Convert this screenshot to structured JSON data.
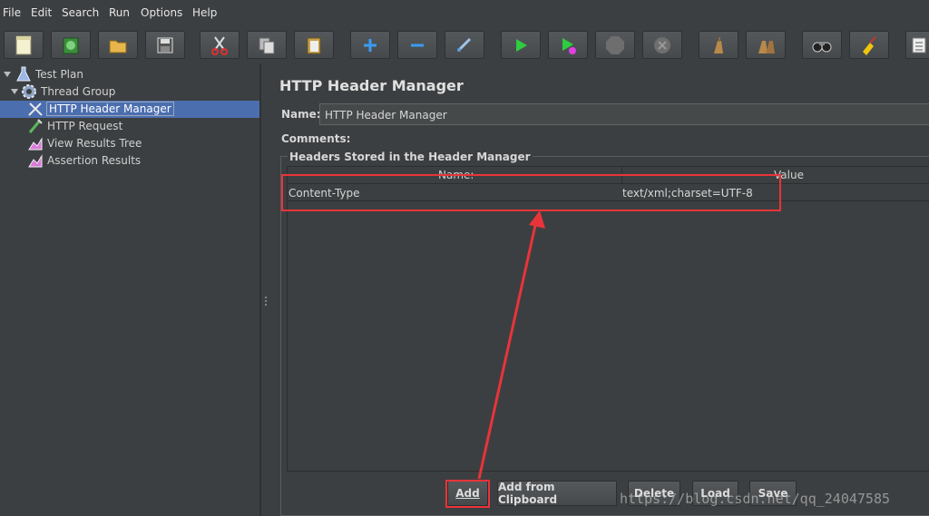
{
  "menu": [
    "File",
    "Edit",
    "Search",
    "Run",
    "Options",
    "Help"
  ],
  "toolbar": {
    "buttons": [
      "new-icon",
      "templates-icon",
      "open-icon",
      "save-icon",
      "cut-icon",
      "copy-icon",
      "paste-icon",
      "expand-icon",
      "collapse-icon",
      "toggle-icon",
      "start-icon",
      "start-no-pause-icon",
      "stop-icon",
      "shutdown-icon",
      "clear-icon",
      "clear-all-icon",
      "search-icon",
      "reset-search-icon",
      "function-helper-icon"
    ]
  },
  "tree": {
    "items": [
      {
        "label": "Test Plan",
        "icon": "test-plan-icon"
      },
      {
        "label": "Thread Group",
        "icon": "thread-group-icon"
      },
      {
        "label": "HTTP Header Manager",
        "icon": "header-manager-icon",
        "selected": true
      },
      {
        "label": "HTTP Request",
        "icon": "sampler-icon"
      },
      {
        "label": "View Results Tree",
        "icon": "listener-icon"
      },
      {
        "label": "Assertion Results",
        "icon": "listener-icon"
      }
    ]
  },
  "panel": {
    "title": "HTTP Header Manager",
    "name_label": "Name:",
    "name_value": "HTTP Header Manager",
    "comments_label": "Comments:",
    "group_title": "Headers Stored in the Header Manager",
    "columns": [
      "Name:",
      "Value"
    ],
    "rows": [
      {
        "name": "Content-Type",
        "value": "text/xml;charset=UTF-8"
      }
    ]
  },
  "buttons": {
    "add": "Add",
    "add_clipboard": "Add from Clipboard",
    "delete": "Delete",
    "load": "Load",
    "save": "Save"
  },
  "watermark": "https://blog.csdn.net/qq_24047585",
  "colors": {
    "background": "#3c3f41",
    "selection": "#4b6eaf",
    "annotation_red": "#e8343a"
  }
}
